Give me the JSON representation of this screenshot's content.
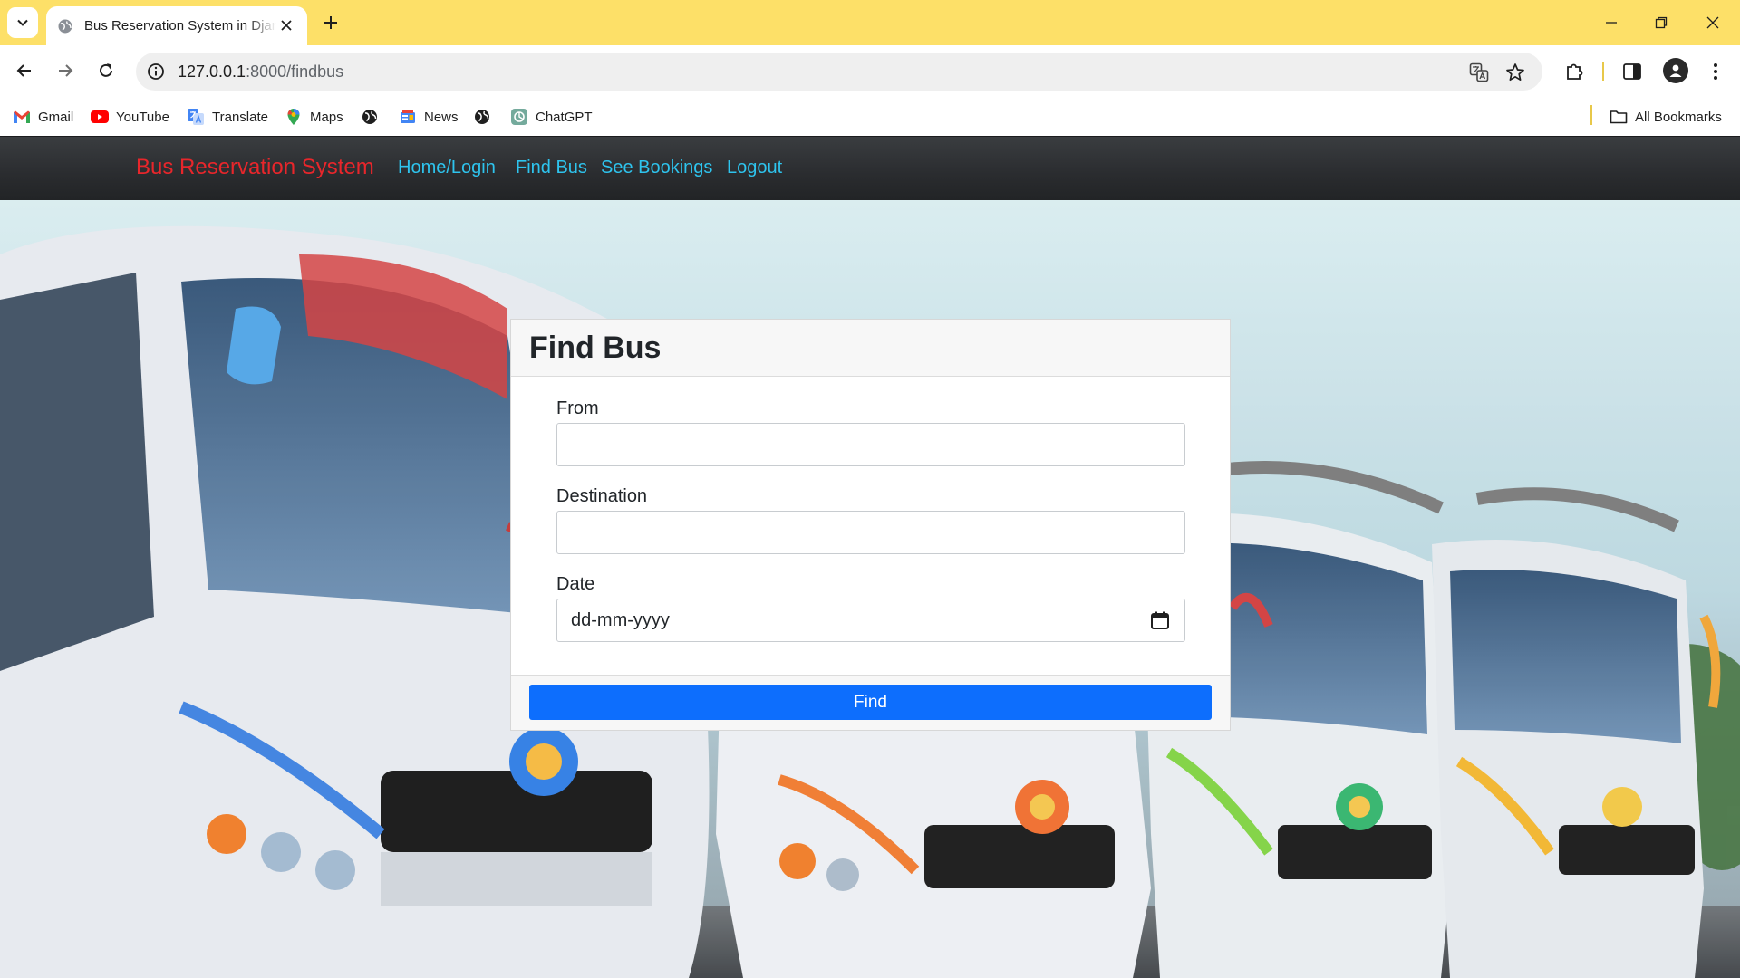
{
  "browser": {
    "tab": {
      "title": "Bus Reservation System in Djan"
    },
    "address": {
      "host": "127.0.0.1",
      "path": ":8000/findbus"
    },
    "bookmarks": [
      {
        "label": "Gmail",
        "icon": "gmail-icon"
      },
      {
        "label": "YouTube",
        "icon": "youtube-icon"
      },
      {
        "label": "Translate",
        "icon": "translate-icon"
      },
      {
        "label": "Maps",
        "icon": "maps-icon"
      },
      {
        "label": "",
        "icon": "globe-icon"
      },
      {
        "label": "News",
        "icon": "news-icon"
      },
      {
        "label": "",
        "icon": "globe-icon"
      },
      {
        "label": "ChatGPT",
        "icon": "chatgpt-icon"
      }
    ],
    "all_bookmarks": "All Bookmarks"
  },
  "navbar": {
    "brand": "Bus Reservation System",
    "links": [
      "Home/Login",
      "Find Bus",
      "See Bookings",
      "Logout"
    ]
  },
  "form": {
    "title": "Find Bus",
    "fields": [
      {
        "label": "From",
        "value": ""
      },
      {
        "label": "Destination",
        "value": ""
      },
      {
        "label": "Date",
        "placeholder": "dd-mm-yyyy"
      }
    ],
    "submit": "Find"
  },
  "colors": {
    "chrome_frame": "#fde068",
    "brand": "#e8262b",
    "nav_link": "#2ec4ee",
    "button": "#0d6efd"
  }
}
